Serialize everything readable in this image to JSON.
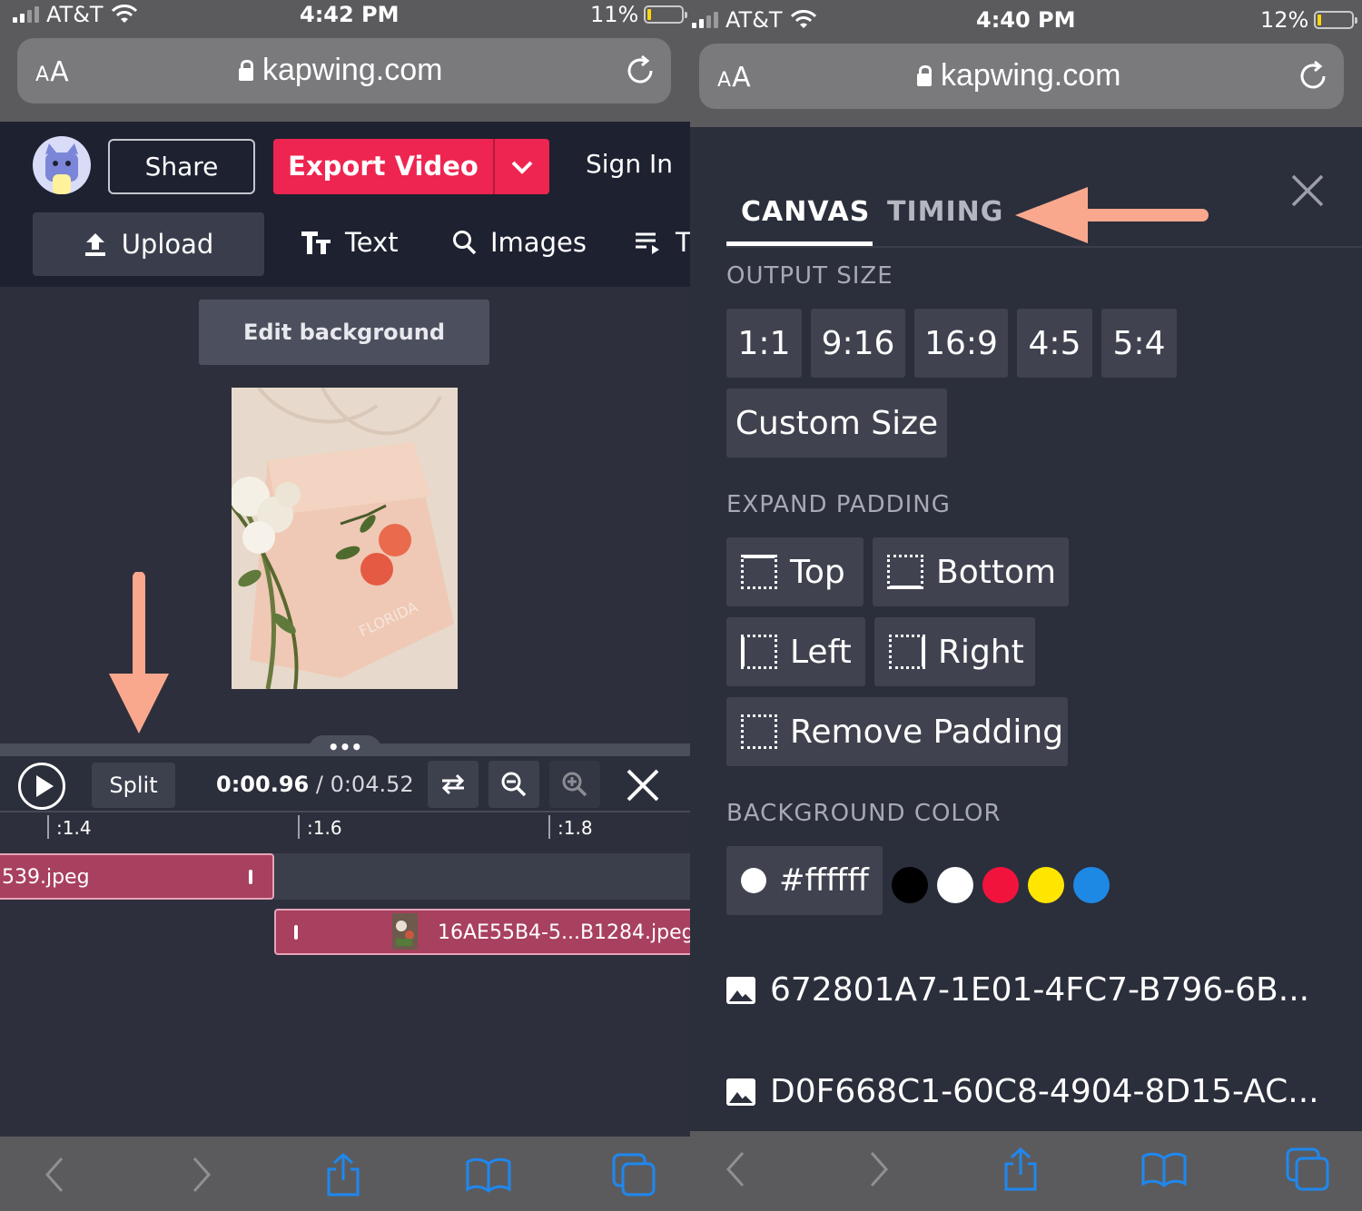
{
  "left": {
    "status": {
      "carrier": "AT&T",
      "time": "4:42 PM",
      "battery": "11%"
    },
    "browser": {
      "text_size": "AA",
      "url": "kapwing.com"
    },
    "header": {
      "share": "Share",
      "export": "Export Video",
      "signin": "Sign In"
    },
    "toolbar": {
      "upload": "Upload",
      "text": "Text",
      "images": "Images",
      "more": "T"
    },
    "edit_background": "Edit background",
    "timeline": {
      "handle": "•••",
      "split": "Split",
      "current": "0:00.96",
      "separator": " / ",
      "total": "0:04.52",
      "ticks": [
        ":1.4",
        ":1.6",
        ":1.8"
      ],
      "clips": [
        "539.jpeg",
        "16AE55B4-5...B1284.jpeg"
      ]
    },
    "photo_caption": "FLORIDA"
  },
  "right": {
    "status": {
      "carrier": "AT&T",
      "time": "4:40 PM",
      "battery": "12%"
    },
    "browser": {
      "text_size": "AA",
      "url": "kapwing.com"
    },
    "tabs": [
      "CANVAS",
      "TIMING"
    ],
    "output_size": {
      "heading": "OUTPUT SIZE",
      "options": [
        "1:1",
        "9:16",
        "16:9",
        "4:5",
        "5:4"
      ],
      "custom": "Custom Size"
    },
    "expand_padding": {
      "heading": "EXPAND PADDING",
      "options": [
        "Top",
        "Bottom",
        "Left",
        "Right"
      ],
      "remove": "Remove Padding"
    },
    "background_color": {
      "heading": "BACKGROUND COLOR",
      "value": "#ffffff",
      "swatches": [
        "#000000",
        "#ffffff",
        "#f2133c",
        "#ffe600",
        "#1e88e5"
      ]
    },
    "files": [
      "672801A7-1E01-4FC7-B796-6B...",
      "D0F668C1-60C8-4904-8D15-AC..."
    ]
  },
  "colors": {
    "accent": "#ee2550",
    "annotation_arrow": "#f9a88e",
    "panel_bg": "#2b2e3b"
  }
}
